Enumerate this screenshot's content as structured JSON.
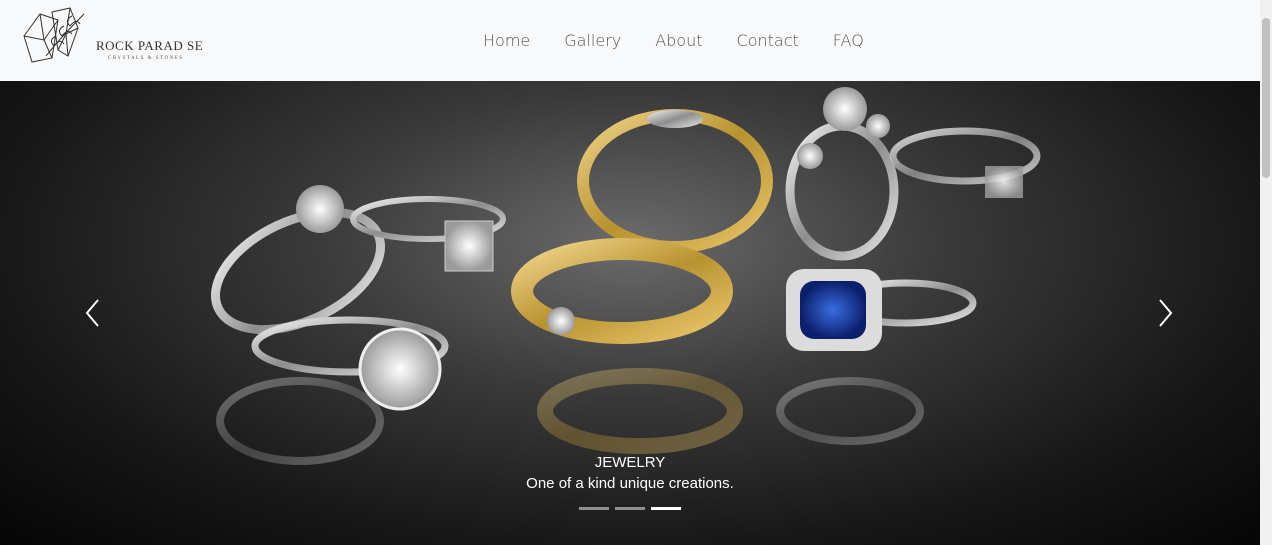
{
  "brand": {
    "name": "ROCK PARAD SE",
    "tagline": "CRYSTALS & STONES"
  },
  "nav": {
    "items": [
      "Home",
      "Gallery",
      "About",
      "Contact",
      "FAQ"
    ]
  },
  "carousel": {
    "slide": {
      "title": "JEWELRY",
      "text": "One of a kind unique creations."
    },
    "indicators": 3,
    "active_indicator": 2,
    "prev_icon": "chevron-left-icon",
    "next_icon": "chevron-right-icon"
  },
  "colors": {
    "navbar_bg": "#f8f9fa",
    "nav_text": "#555555",
    "caption_text": "#ffffff"
  }
}
